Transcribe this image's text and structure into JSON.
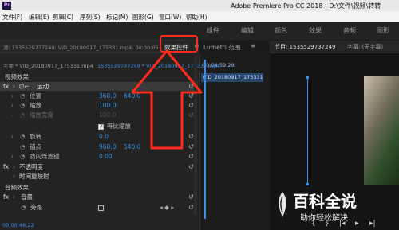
{
  "app": {
    "logo_text": "Pr",
    "title": "Adobe Premiere Pro CC 2018 - D:\\文件\\视频\\转转"
  },
  "menu": [
    "文件(F)",
    "编辑(E)",
    "剪辑(C)",
    "序列(S)",
    "标记(M)",
    "图形(G)",
    "窗口(W)",
    "帮助(H)"
  ],
  "workspaces": [
    "组件",
    "编辑",
    "颜色",
    "效果",
    "音频",
    "图形"
  ],
  "panel": {
    "source_tab": "源: 1535529737249: VID_20180917_175331.mp4: 00;00;05",
    "effect_controls_tab": "效果控件",
    "menu_glyph": "≡",
    "lumetri_tab": "Lumetri 范围",
    "program_tab": "节目: 1535529737249",
    "caption_tab": "字幕: (无字幕)"
  },
  "clip_header": {
    "master": "主要 * VID_20180917_175331.mp4",
    "sequence": "1535529737249 * VID_20180917_175331.mp4",
    "timecode": "00;04;59;29",
    "clip_label": "VID_20180917_175331.mp4"
  },
  "video_effects_header": "视频效果",
  "motion": {
    "label": "运动",
    "position": {
      "label": "位置",
      "x": "360.0",
      "y": "640.0"
    },
    "scale": {
      "label": "缩放",
      "value": "100.0"
    },
    "scale_width": {
      "label": "缩放宽度",
      "value": "100.0"
    },
    "uniform_scale": {
      "label": "等比缩放",
      "checked": true
    },
    "rotation": {
      "label": "旋转",
      "value": "0.0"
    },
    "anchor": {
      "label": "锚点",
      "x": "960.0",
      "y": "540.0"
    },
    "anti_flicker": {
      "label": "防闪烁滤镜",
      "value": "0.00"
    }
  },
  "opacity": {
    "label": "不透明度"
  },
  "time_remap": {
    "label": "时间重映射"
  },
  "audio_effects_header": "音频效果",
  "volume": {
    "label": "音量",
    "bypass_label": "旁路"
  },
  "bottom_timecode": "00;00;46;22",
  "watermark": {
    "title": "百科全说",
    "subtitle": "助你轻松解决"
  },
  "colors": {
    "accent_blue": "#3a8ee6",
    "highlight_red": "#ff2a1a",
    "clip_blue": "#27466e"
  }
}
